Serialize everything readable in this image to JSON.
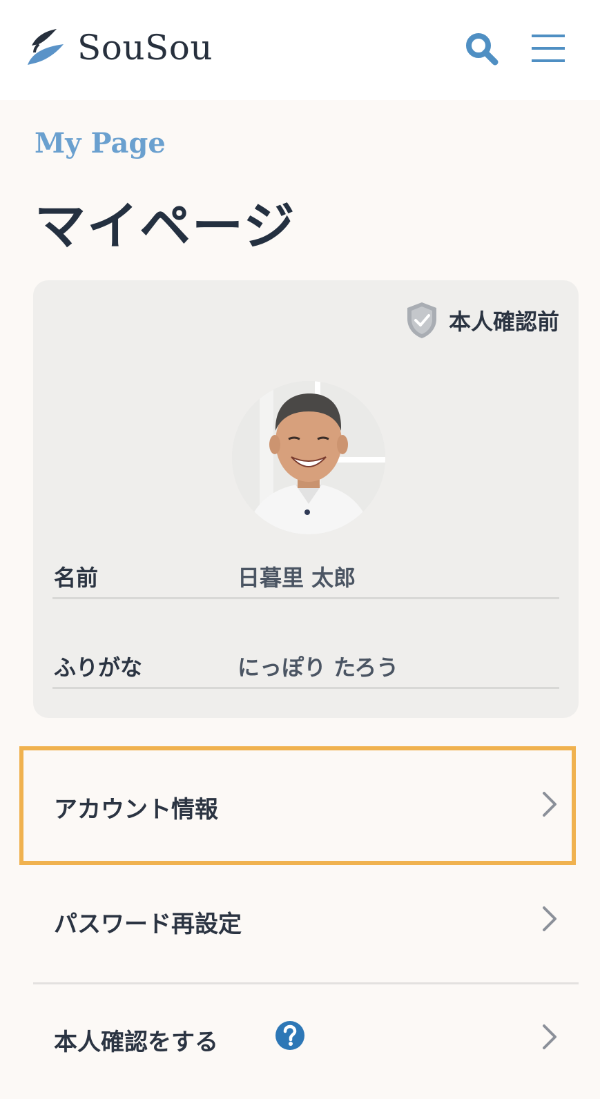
{
  "header": {
    "brand": "SouSou",
    "search_icon": "search-icon",
    "menu_icon": "hamburger-menu-icon",
    "accent_color": "#4f8fc3"
  },
  "page": {
    "eyebrow": "My Page",
    "title": "マイページ"
  },
  "profile": {
    "verification_status": "本人確認前",
    "avatar": "profile-photo",
    "fields": [
      {
        "label": "名前",
        "value": "日暮里 太郎"
      },
      {
        "label": "ふりがな",
        "value": "にっぽり たろう"
      }
    ]
  },
  "menu": [
    {
      "label": "アカウント情報",
      "highlighted": true
    },
    {
      "label": "パスワード再設定"
    },
    {
      "label": "本人確認をする",
      "help_icon": "question-circle-icon"
    }
  ],
  "colors": {
    "highlight": "#f0b24f",
    "background": "#fcf9f6",
    "card": "#efeeec"
  }
}
